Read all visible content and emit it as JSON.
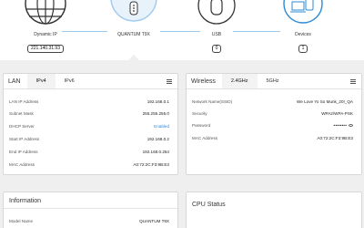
{
  "topology": {
    "internet": {
      "label": "Dynamic IP",
      "value": "221.140.31.93"
    },
    "router": {
      "label": "QUANTUM T9X"
    },
    "usb": {
      "label": "USB",
      "count": "0"
    },
    "devices": {
      "label": "Devices",
      "count": "1"
    },
    "accent_color": "#9ec9ef"
  },
  "lan": {
    "title": "LAN",
    "tabs": [
      "IPv4",
      "IPv6"
    ],
    "active_tab": "IPv4",
    "rows": [
      {
        "key": "LAN IP Address",
        "value": "192.168.0.1"
      },
      {
        "key": "Subnet Mask",
        "value": "255.255.255.0"
      },
      {
        "key": "DHCP Server",
        "value": "Enabled"
      },
      {
        "key": "Start IP Address",
        "value": "192.168.0.2"
      },
      {
        "key": "End IP Address",
        "value": "192.168.0.254"
      },
      {
        "key": "MAC Address",
        "value": "A0:72:2C:F3:9B:E3"
      }
    ]
  },
  "wireless": {
    "title": "Wireless",
    "tabs": [
      "2.4GHz",
      "5GHz"
    ],
    "active_tab": "2.4GHz",
    "rows": [
      {
        "key": "Network Name(SSID)",
        "value": "We Love Yo So Munk_20!_QA"
      },
      {
        "key": "Security",
        "value": "WPA2/WPA-PSK"
      },
      {
        "key": "Password",
        "value": "••••••••"
      },
      {
        "key": "MAC Address",
        "value": "A0:72:2C:F3:9B:E3"
      }
    ]
  },
  "information": {
    "title": "Information",
    "rows": [
      {
        "key": "Model Name",
        "value": "QUANTUM T9X"
      }
    ]
  },
  "cpu": {
    "title": "CPU Status"
  }
}
